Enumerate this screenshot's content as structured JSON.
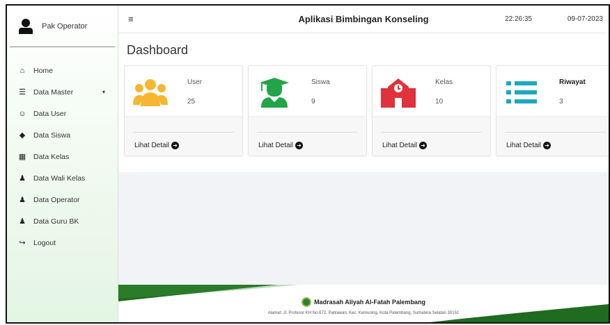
{
  "user": {
    "name": "Pak Operator"
  },
  "sidebar": {
    "items": [
      {
        "label": "Home",
        "icon": "home-icon",
        "glyph": "⌂"
      },
      {
        "label": "Data Master",
        "icon": "database-icon",
        "glyph": "☰",
        "chevron": "▾"
      },
      {
        "label": "Data User",
        "icon": "users-icon",
        "glyph": "☺"
      },
      {
        "label": "Data Siswa",
        "icon": "student-icon",
        "glyph": "◆"
      },
      {
        "label": "Data Kelas",
        "icon": "building-icon",
        "glyph": "▦"
      },
      {
        "label": "Data Wali Kelas",
        "icon": "teacher-icon",
        "glyph": "♟"
      },
      {
        "label": "Data Operator",
        "icon": "operator-icon",
        "glyph": "♟"
      },
      {
        "label": "Data Guru BK",
        "icon": "counselor-icon",
        "glyph": "♟"
      },
      {
        "label": "Logout",
        "icon": "logout-icon",
        "glyph": "↪"
      }
    ]
  },
  "header": {
    "menu_glyph": "≡",
    "title": "Aplikasi Bimbingan Konseling",
    "time": "22:26:35",
    "date": "09-07-2023"
  },
  "main": {
    "title": "Dashboard",
    "cards": [
      {
        "label": "User",
        "value": "25",
        "icon": "users-group-icon",
        "color": "#f5b731",
        "detail": "Lihat Detail"
      },
      {
        "label": "Siswa",
        "value": "9",
        "icon": "graduate-icon",
        "color": "#22a447",
        "detail": "Lihat Detail"
      },
      {
        "label": "Kelas",
        "value": "10",
        "icon": "school-icon",
        "color": "#e0323c",
        "detail": "Lihat Detail"
      },
      {
        "label": "Riwayat",
        "value": "3",
        "icon": "list-icon",
        "color": "#1ba9c0",
        "detail": "Lihat Detail"
      }
    ],
    "arrow_glyph": "➔"
  },
  "footer": {
    "school": "Madrasah Aliyah Al-Fatah Palembang",
    "address": "Alamat: Jl. Profesor KH No.672, Pahlawan, Kec. Kemuning, Kota Palembang, Sumatera Selatan 30151"
  }
}
